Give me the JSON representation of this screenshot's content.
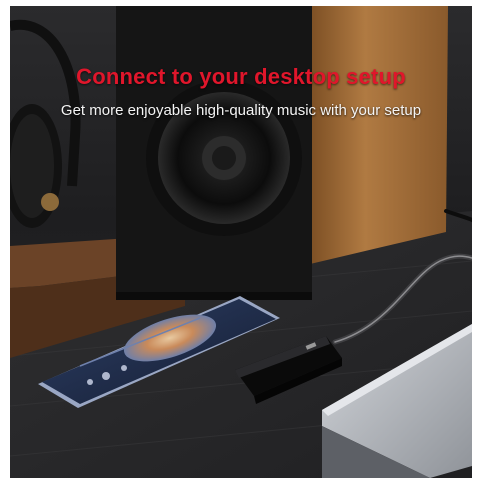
{
  "banner": {
    "headline": "Connect to your desktop setup",
    "subline": "Get more enjoyable high-quality music with your setup"
  },
  "colors": {
    "headline": "#e0162b",
    "subline": "#f4f4f4",
    "desk": "#2a2a2c",
    "speaker_wood": "#a8733d",
    "speaker_body": "#161616",
    "laptop": "#b9bcc1"
  },
  "scene": {
    "objects": [
      "headphones-icon",
      "speaker-icon",
      "phone-icon",
      "dac-dongle-icon",
      "laptop-icon",
      "usb-cable-icon"
    ]
  }
}
